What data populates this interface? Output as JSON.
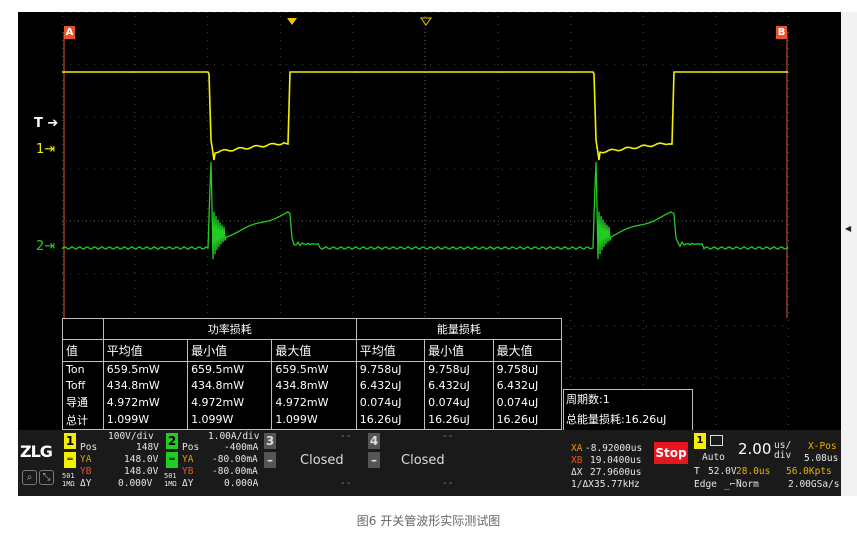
{
  "colors": {
    "ch1": "#f3f000",
    "ch2": "#22cc22",
    "cursor": "#e8542a",
    "grid": "#4a4a4a",
    "stop": "#e8141e"
  },
  "markers": {
    "a": "A",
    "b": "B",
    "trigger": "T",
    "ch1": "1",
    "ch2": "2"
  },
  "measure_table": {
    "group_power": "功率损耗",
    "group_energy": "能量损耗",
    "headers": [
      "值",
      "平均值",
      "最小值",
      "最大值",
      "平均值",
      "最小值",
      "最大值"
    ],
    "rows": [
      [
        "Ton",
        "659.5mW",
        "659.5mW",
        "659.5mW",
        "9.758uJ",
        "9.758uJ",
        "9.758uJ"
      ],
      [
        "Toff",
        "434.8mW",
        "434.8mW",
        "434.8mW",
        "6.432uJ",
        "6.432uJ",
        "6.432uJ"
      ],
      [
        "导通",
        "4.972mW",
        "4.972mW",
        "4.972mW",
        "0.074uJ",
        "0.074uJ",
        "0.074uJ"
      ],
      [
        "总计",
        "1.099W",
        "1.099W",
        "1.099W",
        "16.26uJ",
        "16.26uJ",
        "16.26uJ"
      ]
    ],
    "period_count": "周期数:1",
    "total_energy": "总能量损耗:16.26uJ"
  },
  "status": {
    "logo": "ZLG",
    "ch1": {
      "num": "1",
      "scale": "100V/div",
      "pos_label": "Pos",
      "pos": "148V",
      "ya_label": "YA",
      "ya": "148.0V",
      "yb_label": "YB",
      "yb": "148.0V",
      "dy_label": "ΔY",
      "dy": "0.000V",
      "imp1": "501",
      "imp2": "1MΩ"
    },
    "ch2": {
      "num": "2",
      "scale": "1.00A/div",
      "pos_label": "Pos",
      "pos": "-400mA",
      "ya_label": "YA",
      "ya": "-80.00mA",
      "yb_label": "YB",
      "yb": "-80.00mA",
      "dy_label": "ΔY",
      "dy": "0.000A",
      "imp1": "501",
      "imp2": "1MΩ"
    },
    "ch3": {
      "num": "3",
      "dash": "--",
      "state": "Closed"
    },
    "ch4": {
      "num": "4",
      "dash": "--",
      "state": "Closed"
    },
    "cursors": {
      "xa_label": "XA",
      "xa": "-8.92000us",
      "xb_label": "XB",
      "xb": "19.0400us",
      "dx_label": "ΔX",
      "dx": "27.9600us",
      "inv_label": "1/ΔX",
      "inv": "35.77kHz"
    },
    "run": {
      "stop": "Stop",
      "mode": "Auto",
      "trig_label": "T",
      "trig_level": "52.0V",
      "edge": "Edge"
    },
    "timebase": {
      "value": "2.00",
      "unit_top": "us/",
      "unit_bot": "div",
      "xpos_label": "X-Pos",
      "xpos": "5.08us",
      "delay": "28.0us",
      "points": "56.0Kpts",
      "mode": "Norm",
      "rate": "2.00GSa/s"
    }
  },
  "caption": "图6  开关管波形实际测试图"
}
